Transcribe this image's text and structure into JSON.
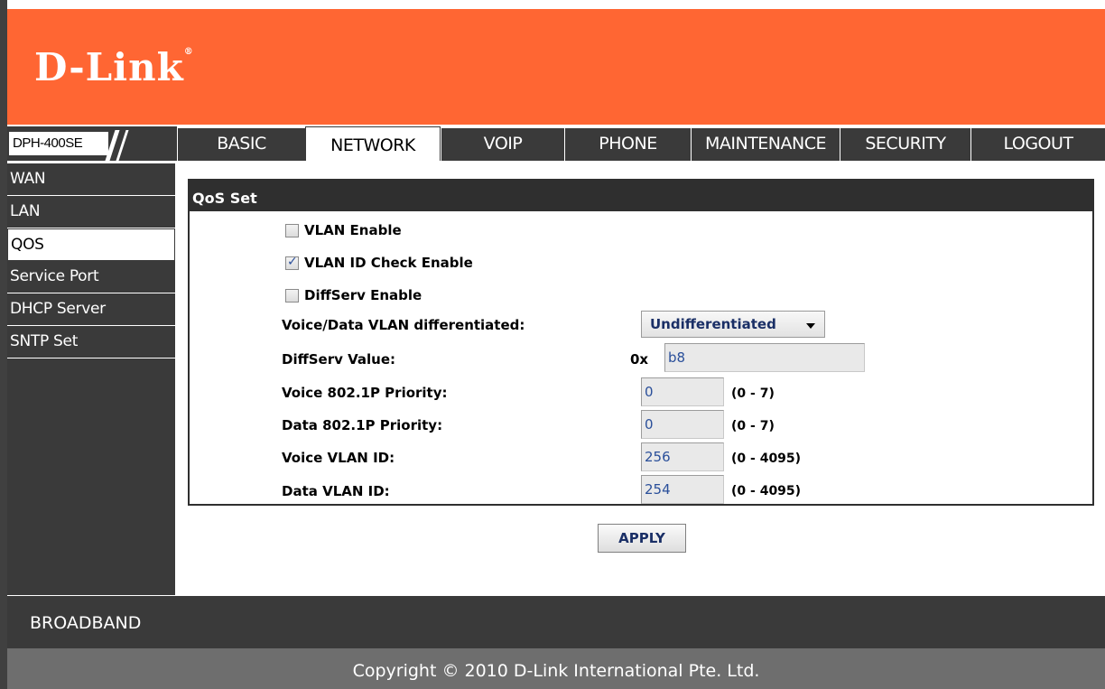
{
  "brand": {
    "logo_text": "D-Link",
    "trademark": "®",
    "accent_color": "#ff6633"
  },
  "model": "DPH-400SE",
  "tabs": [
    {
      "label": "BASIC",
      "active": false
    },
    {
      "label": "NETWORK",
      "active": true
    },
    {
      "label": "VOIP",
      "active": false
    },
    {
      "label": "PHONE",
      "active": false
    },
    {
      "label": "MAINTENANCE",
      "active": false
    },
    {
      "label": "SECURITY",
      "active": false
    },
    {
      "label": "LOGOUT",
      "active": false
    }
  ],
  "sidebar": {
    "items": [
      {
        "label": "WAN",
        "active": false
      },
      {
        "label": "LAN",
        "active": false
      },
      {
        "label": "QOS",
        "active": true
      },
      {
        "label": "Service Port",
        "active": false
      },
      {
        "label": "DHCP Server",
        "active": false
      },
      {
        "label": "SNTP Set",
        "active": false
      }
    ]
  },
  "panel": {
    "title": "QoS Set",
    "checkboxes": [
      {
        "label": "VLAN Enable",
        "checked": false
      },
      {
        "label": "VLAN ID Check Enable",
        "checked": true
      },
      {
        "label": "DiffServ Enable",
        "checked": false
      }
    ],
    "voice_data_diff": {
      "label": "Voice/Data VLAN differentiated:",
      "selected": "Undifferentiated"
    },
    "diffserv_value": {
      "label": "DiffServ Value:",
      "prefix": "0x",
      "value": "b8"
    },
    "voice_priority": {
      "label": "Voice 802.1P Priority:",
      "value": "0",
      "range": "(0 - 7)"
    },
    "data_priority": {
      "label": "Data 802.1P Priority:",
      "value": "0",
      "range": "(0 - 7)"
    },
    "voice_vlan_id": {
      "label": "Voice VLAN ID:",
      "value": "256",
      "range": "(0 - 4095)"
    },
    "data_vlan_id": {
      "label": "Data VLAN ID:",
      "value": "254",
      "range": "(0 - 4095)"
    }
  },
  "apply_label": "APPLY",
  "footer": {
    "broadband": "BROADBAND",
    "copyright": "Copyright © 2010 D-Link International Pte. Ltd."
  }
}
